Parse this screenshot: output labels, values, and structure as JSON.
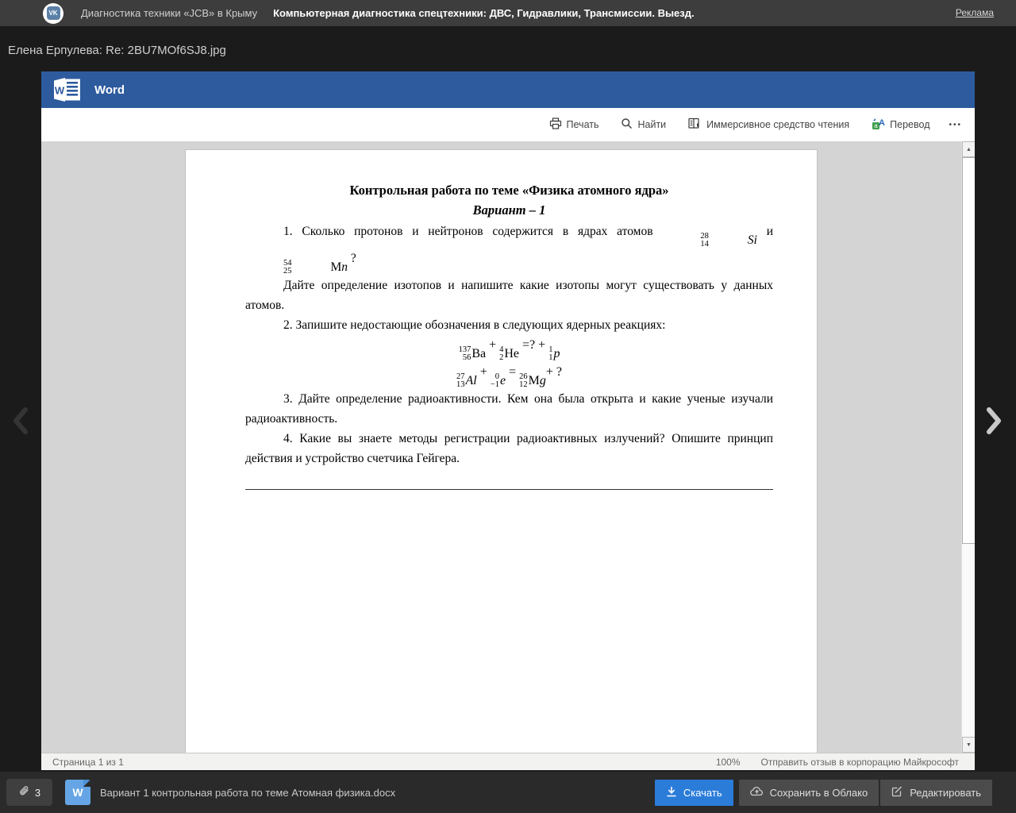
{
  "ad_bar": {
    "vk_logo": "VK",
    "title": "Диагностика техники «JCB» в Крыму",
    "text": "Компьютерная диагностика спецтехники: ДВС, Гидравлики, Трансмиссии. Выезд.",
    "ad_label": "Реклама"
  },
  "attachment_title": "Елена Ерпулева: Re: 2BU7MOf6SJ8.jpg",
  "word": {
    "brand": "Word",
    "logo_letter": "W",
    "toolbar": {
      "print": "Печать",
      "find": "Найти",
      "immersive": "Иммерсивное средство чтения",
      "translate": "Перевод",
      "more_icon": "•••"
    },
    "scroll": {
      "up_icon": "▲",
      "down_icon": "▼"
    },
    "status": {
      "page_info": "Страница 1 из 1",
      "zoom": "100%",
      "feedback": "Отправить отзыв в корпорацию Майкрософт"
    }
  },
  "doc": {
    "title": "Контрольная  работа по теме «Физика атомного ядра»",
    "variant": "Вариант – 1",
    "q1_tokens": [
      {
        "t": "1. Сколько протонов и нейтронов содержится в ядрах атомов "
      },
      {
        "n": {
          "m": "28",
          "c": "14",
          "si": "Si"
        }
      },
      {
        "t": "  и "
      },
      {
        "n": {
          "m": "54",
          "c": "25",
          "s": "M",
          "si": "n"
        }
      },
      {
        "t": " ?"
      }
    ],
    "q1_cont": "Дайте определение изотопов и напишите какие изотопы могут существовать у данных атомов.",
    "q2": "2. Запишите  недостающие обозначения в следующих ядерных реакциях:",
    "reactions": {
      "r1": [
        {
          "n": {
            "m": "137",
            "c": "56",
            "s": "Ba"
          }
        },
        {
          "t": " + "
        },
        {
          "n": {
            "m": "4",
            "c": "2",
            "s": "He"
          }
        },
        {
          "t": " =? + "
        },
        {
          "n": {
            "m": "1",
            "c": "1",
            "si": "p"
          }
        }
      ],
      "r2": [
        {
          "n": {
            "m": "27",
            "c": "13",
            "si": "Al"
          }
        },
        {
          "t": " +  "
        },
        {
          "n": {
            "m": "0",
            "c": "−1",
            "si": "e"
          }
        },
        {
          "t": "  =  "
        },
        {
          "n": {
            "m": "26",
            "c": "12",
            "s": "M",
            "si": "g"
          }
        },
        {
          "t": "+ ?"
        }
      ]
    },
    "q3": "3. Дайте определение радиоактивности. Кем она была открыта и какие ученые изучали радиоактивность.",
    "q4": "4. Какие вы знаете методы регистрации радиоактивных излучений? Опишите принцип действия и устройство счетчика Гейгера."
  },
  "bottom": {
    "attach_count": "3",
    "file_letter": "W",
    "file_name": "Вариант 1 контрольная работа по теме Атомная физика.docx",
    "download": "Скачать",
    "save_cloud": "Сохранить в Облако",
    "edit": "Редактировать"
  }
}
